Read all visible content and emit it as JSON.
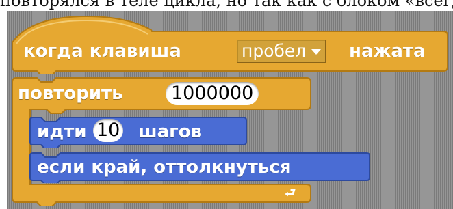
{
  "top_text": "повторялся в теле цикла, но так как с блоком «всегда»",
  "hat_block": {
    "prefix": "когда клавиша",
    "key_value": "пробел",
    "suffix": "нажата",
    "color": "#e6a831"
  },
  "repeat_block": {
    "label": "повторить",
    "count": "1000000",
    "color": "#e6a831"
  },
  "motion_blocks": [
    {
      "before": "идти",
      "value": "10",
      "after": "шагов"
    },
    {
      "label": "если край, оттолкнуться"
    }
  ],
  "motion_color": "#4a6cd4",
  "icons": {
    "loop_arrow": "loop-arrow-icon",
    "dropdown_caret": "chevron-down-icon"
  }
}
